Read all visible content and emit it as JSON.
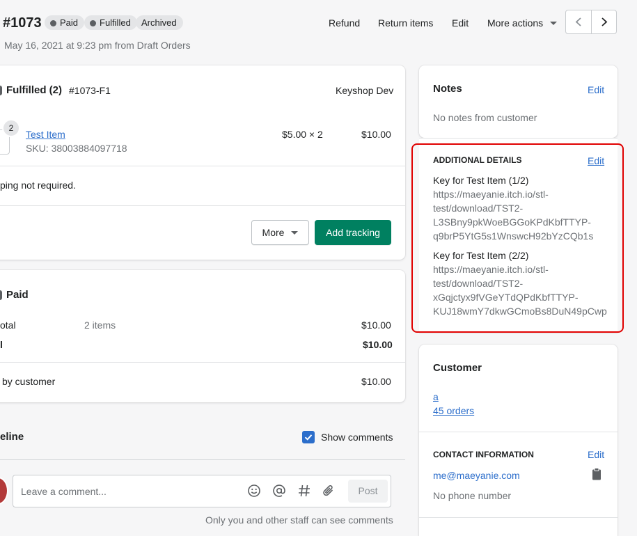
{
  "header": {
    "order_number": "#1073",
    "badges": [
      "Paid",
      "Fulfilled",
      "Archived"
    ],
    "subtitle": "May 16, 2021 at 9:23 pm from Draft Orders",
    "actions": {
      "refund": "Refund",
      "return_items": "Return items",
      "edit": "Edit",
      "more_actions": "More actions"
    }
  },
  "fulfilled": {
    "title": "Fulfilled (2)",
    "code": "#1073-F1",
    "location": "Keyshop Dev",
    "item": {
      "qty": "2",
      "name": "Test Item",
      "sku": "SKU: 38003884097718",
      "unit": "$5.00 × 2",
      "total": "$10.00"
    },
    "shipping_note": "ping not required.",
    "more_button": "More",
    "add_tracking_button": "Add tracking"
  },
  "payment": {
    "title": "Paid",
    "rows": [
      {
        "label": "otal",
        "middle": "2 items",
        "value": "$10.00"
      },
      {
        "label": "l",
        "middle": "",
        "value": "$10.00"
      },
      {
        "label": "by customer",
        "middle": "",
        "value": "$10.00"
      }
    ]
  },
  "timeline": {
    "title": "eline",
    "show_comments_label": "Show comments",
    "comment_placeholder": "Leave a comment...",
    "post_button": "Post",
    "footer_note": "Only you and other staff can see comments"
  },
  "notes": {
    "title": "Notes",
    "edit": "Edit",
    "body": "No notes from customer"
  },
  "additional_details": {
    "title": "ADDITIONAL DETAILS",
    "edit": "Edit",
    "entries": [
      {
        "label": "Key for Test Item (1/2)",
        "lines": [
          "https://maeyanie.itch.io/stl-",
          "test/download/TST2-",
          "L3SBny9pkWoeBGGoKPdKbfTTYP-",
          "q9brP5YtG5s1WnswcH92bYzCQb1s"
        ]
      },
      {
        "label": "Key for Test Item (2/2)",
        "lines": [
          "https://maeyanie.itch.io/stl-",
          "test/download/TST2-",
          "xGqjctyx9fVGeYTdQPdKbfTTYP-",
          "KUJ18wmY7dkwGCmoBs8DuN49pCwp"
        ]
      }
    ]
  },
  "customer": {
    "title": "Customer",
    "name": "a",
    "orders": "45 orders",
    "contact_title": "CONTACT INFORMATION",
    "contact_edit": "Edit",
    "email": "me@maeyanie.com",
    "phone": "No phone number"
  },
  "colors": {
    "primary": "#008060",
    "link": "#2c6ecb",
    "highlight": "#e00000"
  }
}
